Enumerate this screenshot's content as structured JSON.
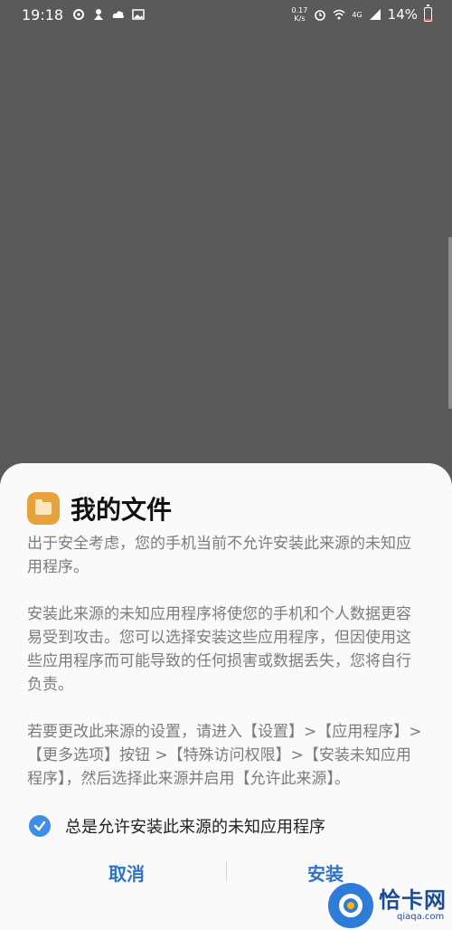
{
  "status_bar": {
    "time": "19:18",
    "net_speed_value": "0.17",
    "net_speed_unit": "K/s",
    "network_type": "4G",
    "battery_percent": "14%",
    "battery_level": 0.14,
    "battery_color": "#e85a4f",
    "left_icons": [
      "sync-icon",
      "notification-icon",
      "cloud-icon",
      "image-icon"
    ],
    "right_icons": [
      "alarm-icon",
      "wifi-icon",
      "signal-icon"
    ]
  },
  "dialog": {
    "app_icon": "folder-icon",
    "title": "我的文件",
    "paragraph1": "出于安全考虑，您的手机当前不允许安装此来源的未知应用程序。",
    "paragraph2": "安装此来源的未知应用程序将使您的手机和个人数据更容易受到攻击。您可以选择安装这些应用程序，但因使用这些应用程序而可能导致的任何损害或数据丢失，您将自行负责。",
    "paragraph3": "若要更改此来源的设置，请进入【设置】>【应用程序】>【更多选项】按钮 >【特殊访问权限】>【安装未知应用程序】，然后选择此来源并启用【允许此来源】。",
    "checkbox_label": "总是允许安装此来源的未知应用程序",
    "checkbox_checked": true,
    "cancel_label": "取消",
    "install_label": "安装",
    "accent_color": "#2f74c4"
  },
  "watermark": {
    "main": "恰卡网",
    "sub": "qiaqa.com"
  }
}
